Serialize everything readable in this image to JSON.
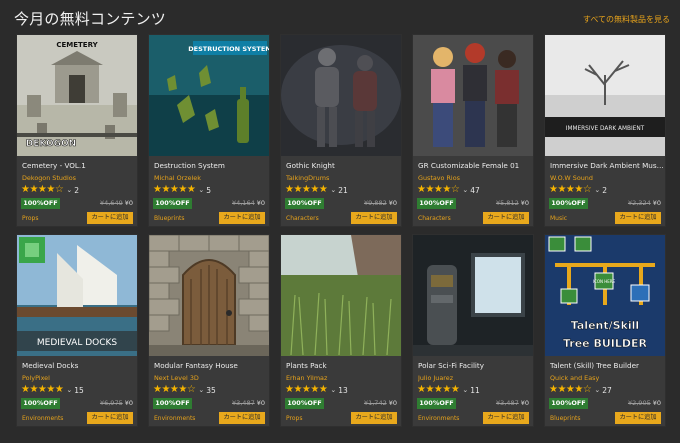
{
  "header": {
    "title": "今月の無料コンテンツ",
    "see_all": "すべての無料製品を見る"
  },
  "colors": {
    "accent": "#e7a31b",
    "badge": "#2f7d32",
    "stars": "#f5b400",
    "background": "#2b2b2b",
    "card": "#3a3a3a"
  },
  "labels": {
    "add_to_cart": "カートに追加",
    "free_badge": "100%OFF",
    "free_price": "¥0"
  },
  "products": [
    {
      "name": "Cemetery - VOL.1",
      "publisher": "Dekogon Studios",
      "rating_count": "2",
      "old_price": "¥4,649",
      "category": "Props",
      "overlay_text": [
        "CEMETERY",
        "DEKOGON"
      ],
      "stars": 4.5
    },
    {
      "name": "Destruction System",
      "publisher": "Michal Orzelek",
      "rating_count": "5",
      "old_price": "¥4,164",
      "category": "Blueprints",
      "overlay_text": [
        "DESTRUCTION SYSTEM"
      ],
      "stars": 5
    },
    {
      "name": "Gothic Knight",
      "publisher": "TalkingDrums",
      "rating_count": "21",
      "old_price": "¥9,882",
      "category": "Characters",
      "overlay_text": [],
      "stars": 5
    },
    {
      "name": "GR Customizable Female 01",
      "publisher": "Gustavo Rios",
      "rating_count": "47",
      "old_price": "¥5,812",
      "category": "Characters",
      "overlay_text": [],
      "stars": 4
    },
    {
      "name": "Immersive Dark Ambient Music P...",
      "publisher": "W.O.W Sound",
      "rating_count": "2",
      "old_price": "¥2,324",
      "category": "Music",
      "overlay_text": [
        "IMMERSIVE DARK AMBIENT"
      ],
      "stars": 4.5
    },
    {
      "name": "Medieval Docks",
      "publisher": "PolyPixel",
      "rating_count": "15",
      "old_price": "¥6,975",
      "category": "Environments",
      "overlay_text": [
        "MEDIEVAL DOCKS"
      ],
      "stars": 5
    },
    {
      "name": "Modular Fantasy House",
      "publisher": "Next Level 3D",
      "rating_count": "35",
      "old_price": "¥3,487",
      "category": "Environments",
      "overlay_text": [],
      "stars": 4.5
    },
    {
      "name": "Plants Pack",
      "publisher": "Erhan Yilmaz",
      "rating_count": "13",
      "old_price": "¥1,742",
      "category": "Props",
      "overlay_text": [],
      "stars": 5
    },
    {
      "name": "Polar Sci-Fi Facility",
      "publisher": "Julio Juarez",
      "rating_count": "11",
      "old_price": "¥3,487",
      "category": "Environments",
      "overlay_text": [],
      "stars": 5
    },
    {
      "name": "Talent (Skill) Tree Builder",
      "publisher": "Quick and Easy",
      "rating_count": "27",
      "old_price": "¥2,905",
      "category": "Blueprints",
      "overlay_text": [
        "Talent/Skill",
        "Tree BUILDER",
        "ICON HERE"
      ],
      "stars": 4.5
    }
  ]
}
